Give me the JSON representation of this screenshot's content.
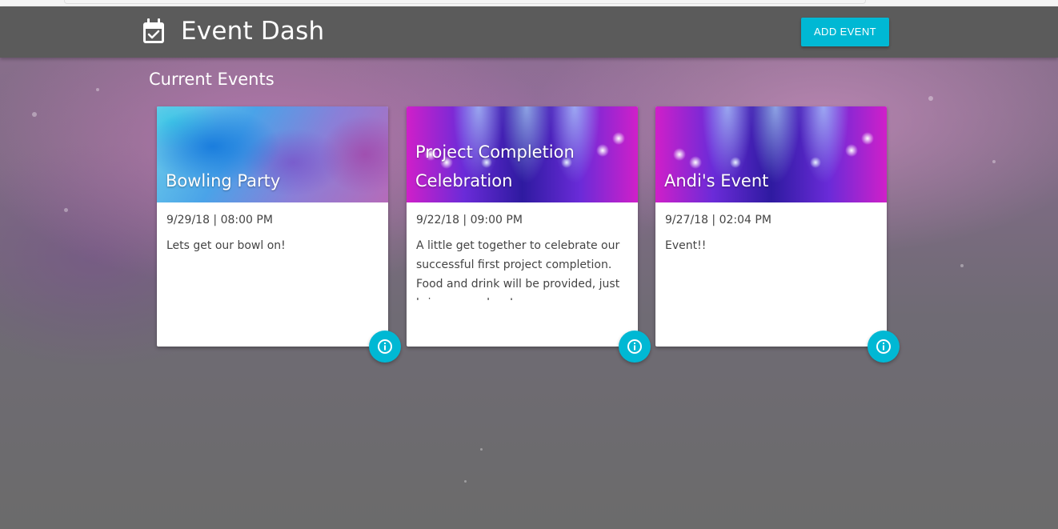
{
  "header": {
    "title": "Event Dash",
    "add_button_label": "ADD EVENT",
    "brand_icon": "calendar-check-icon"
  },
  "main": {
    "section_title": "Current Events",
    "events": [
      {
        "title": "Bowling Party",
        "datetime": "9/29/18 | 08:00 PM",
        "description": "Lets get our bowl on!",
        "image": "watercolor"
      },
      {
        "title": "Project Completion Celebration",
        "datetime": "9/22/18 | 09:00 PM",
        "description": "A little get together to celebrate our successful first project completion. Food and drink will be provided, just bring yourselves!",
        "image": "stage-lights"
      },
      {
        "title": "Andi's Event",
        "datetime": "9/27/18 | 02:04 PM",
        "description": "Event!!",
        "image": "stage-lights"
      }
    ]
  },
  "colors": {
    "accent": "#00b8d4",
    "header_bg": "#5b5b5b",
    "text": "#444444"
  },
  "icons": {
    "info": "info-icon"
  }
}
